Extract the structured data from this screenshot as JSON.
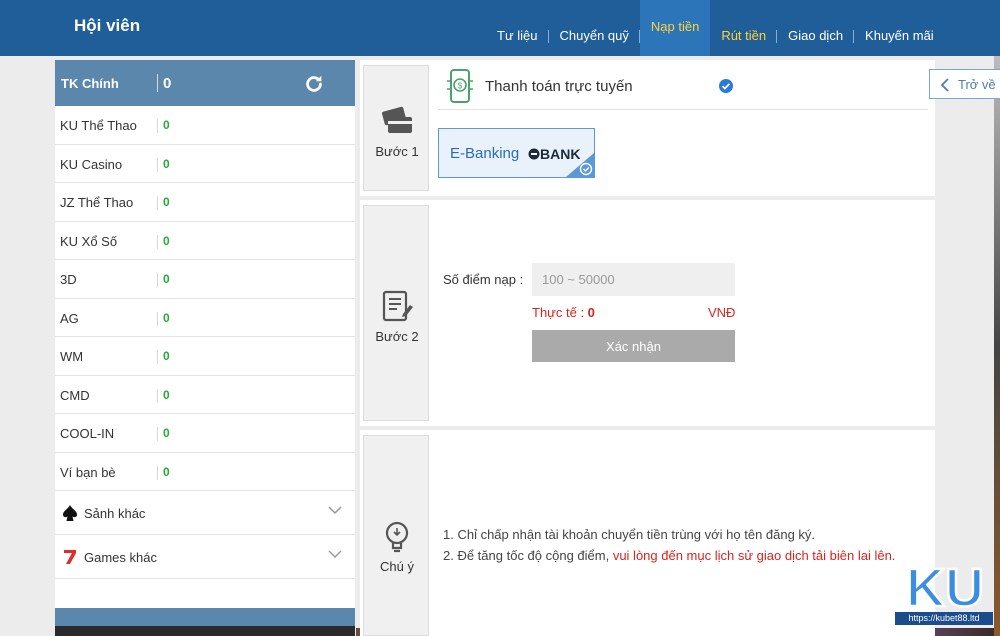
{
  "header": {
    "title": "Hội viên",
    "nav": [
      "Tư liệu",
      "Chuyển quỹ",
      "Nạp tiền",
      "Rút tiền",
      "Giao dịch",
      "Khuyến mãi"
    ],
    "active_index": 2
  },
  "sidebar": {
    "main_label": "TK Chính",
    "main_value": "0",
    "accounts": [
      {
        "label": "KU Thể Thao",
        "value": "0"
      },
      {
        "label": "KU Casino",
        "value": "0"
      },
      {
        "label": "JZ Thể Thao",
        "value": "0"
      },
      {
        "label": "KU Xổ Số",
        "value": "0"
      },
      {
        "label": "3D",
        "value": "0"
      },
      {
        "label": "AG",
        "value": "0"
      },
      {
        "label": "WM",
        "value": "0"
      },
      {
        "label": "CMD",
        "value": "0"
      },
      {
        "label": "COOL-IN",
        "value": "0"
      },
      {
        "label": "Ví bạn bè",
        "value": "0"
      }
    ],
    "expandables": [
      {
        "label": "Sảnh khác",
        "icon": "spade-icon"
      },
      {
        "label": "Games khác",
        "icon": "seven-icon"
      }
    ]
  },
  "step1": {
    "label": "Bước 1",
    "title": "Thanh toán trực tuyến",
    "back_label": "Trở về",
    "method_label": "E-Banking",
    "method_logo": "BANK"
  },
  "step2": {
    "label": "Bước 2",
    "amount_label": "Số điểm nạp :",
    "amount_placeholder": "100 ~ 50000",
    "actual_label": "Thực tế : ",
    "actual_value": "0",
    "currency": "VNĐ",
    "confirm_label": "Xác nhận"
  },
  "step3": {
    "label": "Chú ý",
    "note1": "1.  Chỉ chấp nhận tài khoản chuyển tiền trùng với họ tên đăng ký.",
    "note2_prefix": "2.  Để tăng tốc độ cộng điểm, ",
    "note2_red": "vui lòng đến mục lịch sử giao dịch tải biên lai lên."
  },
  "watermark": {
    "text": "KU",
    "url": "https://kubet88.ltd"
  },
  "colors": {
    "header_bg": "#1f5e98",
    "accent_gold": "#ffd23a",
    "sidebar_head": "#5b87ad",
    "balance_green": "#2aa63a",
    "warning_red": "#d9231f"
  }
}
